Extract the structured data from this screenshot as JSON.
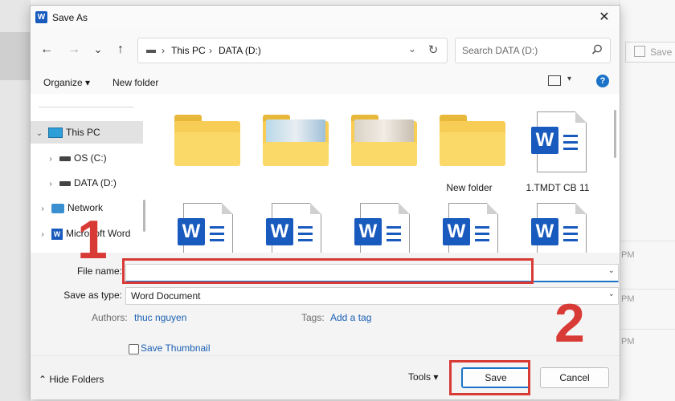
{
  "dialog": {
    "title": "Save As",
    "app_icon_letter": "W"
  },
  "background": {
    "save_label": "Save",
    "times": [
      "PM",
      "PM",
      "PM"
    ]
  },
  "nav": {
    "back_icon": "←",
    "forward_icon": "→",
    "recent_icon": "⌄",
    "up_icon": "↑",
    "address": [
      "This PC",
      "DATA (D:)"
    ],
    "search_placeholder": "Search DATA (D:)"
  },
  "commands": {
    "organize": "Organize ▾",
    "new_folder": "New folder"
  },
  "tree": [
    {
      "label": "This PC",
      "icon": "monitor-icon",
      "selected": true
    },
    {
      "label": "OS (C:)",
      "icon": "drive-icon"
    },
    {
      "label": "DATA (D:)",
      "icon": "drive-icon"
    },
    {
      "label": "Network",
      "icon": "network-icon"
    },
    {
      "label": "Microsoft Word",
      "icon": "word-icon"
    }
  ],
  "files_row1": [
    {
      "type": "folder",
      "label": ""
    },
    {
      "type": "folder-photo",
      "label": ""
    },
    {
      "type": "folder-photo2",
      "label": ""
    },
    {
      "type": "folder",
      "label": "New folder"
    },
    {
      "type": "doc",
      "label": "1.TMDT CB 11"
    }
  ],
  "files_row2": [
    {
      "type": "doc"
    },
    {
      "type": "doc"
    },
    {
      "type": "doc"
    },
    {
      "type": "doc"
    },
    {
      "type": "doc"
    }
  ],
  "form": {
    "file_name_label": "File name:",
    "file_name_value": "",
    "save_type_label": "Save as type:",
    "save_type_value": "Word Document",
    "authors_label": "Authors:",
    "authors_value": "thuc nguyen",
    "tags_label": "Tags:",
    "tags_value": "Add a tag",
    "thumbnail_label": "Save Thumbnail"
  },
  "footer": {
    "hide_folders": "Hide Folders",
    "tools": "Tools ▾",
    "save": "Save",
    "cancel": "Cancel"
  },
  "annotations": {
    "step1": "1",
    "step2": "2",
    "color": "#d83a36"
  },
  "colors": {
    "accent": "#1a73c8",
    "word": "#185abd",
    "folder": "#f7cd55"
  }
}
